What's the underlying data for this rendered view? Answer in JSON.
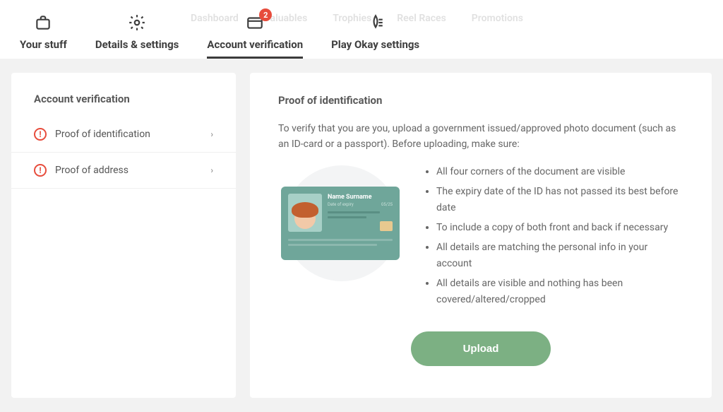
{
  "tabs": {
    "your_stuff": "Your stuff",
    "details_settings": "Details & settings",
    "account_verification": "Account verification",
    "play_okay": "Play Okay settings",
    "badge_count": "2"
  },
  "faded_tabs": [
    "Dashboard",
    "Valuables",
    "Trophies",
    "Reel Races",
    "Promotions"
  ],
  "sidebar": {
    "title": "Account verification",
    "items": [
      {
        "label": "Proof of identification"
      },
      {
        "label": "Proof of address"
      }
    ]
  },
  "main": {
    "title": "Proof of identification",
    "desc": "To verify that you are you, upload a government issued/approved photo document (such as an ID-card or a passport). Before uploading, make sure:",
    "requirements": [
      "All four corners of the document are visible",
      "The expiry date of the ID has not passed its best before date",
      "To include a copy of both front and back if necessary",
      "All details are matching the personal info in your account",
      "All details are visible and nothing has been covered/altered/cropped"
    ],
    "id_card": {
      "name": "Name Surname",
      "date_label": "Date of expiry",
      "date_value": "05/25"
    },
    "upload_label": "Upload"
  }
}
